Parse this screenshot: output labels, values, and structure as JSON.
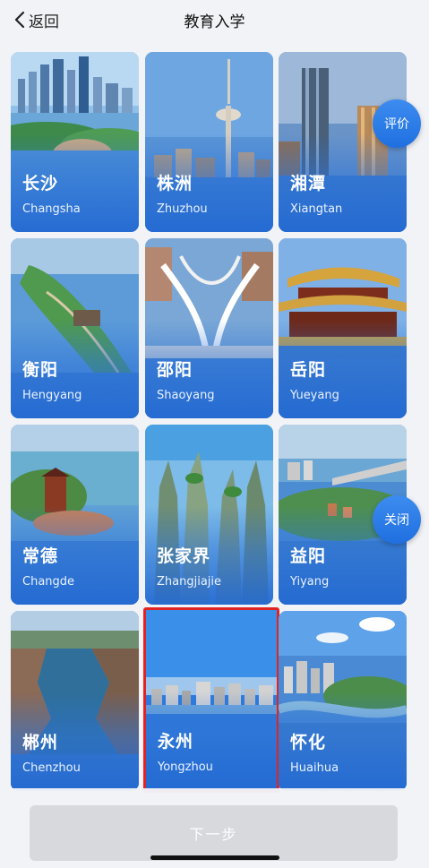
{
  "header": {
    "back_label": "返回",
    "title": "教育入学"
  },
  "cities": [
    {
      "cn": "长沙",
      "en": "Changsha"
    },
    {
      "cn": "株洲",
      "en": "Zhuzhou"
    },
    {
      "cn": "湘潭",
      "en": "Xiangtan"
    },
    {
      "cn": "衡阳",
      "en": "Hengyang"
    },
    {
      "cn": "邵阳",
      "en": "Shaoyang"
    },
    {
      "cn": "岳阳",
      "en": "Yueyang"
    },
    {
      "cn": "常德",
      "en": "Changde"
    },
    {
      "cn": "张家界",
      "en": "Zhangjiajie"
    },
    {
      "cn": "益阳",
      "en": "Yiyang"
    },
    {
      "cn": "郴州",
      "en": "Chenzhou"
    },
    {
      "cn": "永州",
      "en": "Yongzhou"
    },
    {
      "cn": "怀化",
      "en": "Huaihua"
    }
  ],
  "selected_city": "永州",
  "floating": {
    "rate_label": "评价",
    "close_label": "关闭"
  },
  "footer": {
    "next_label": "下一步"
  },
  "colors": {
    "accent": "#2f7fe8",
    "selected_border": "#e02424",
    "disabled_button": "#d7d9dd"
  }
}
